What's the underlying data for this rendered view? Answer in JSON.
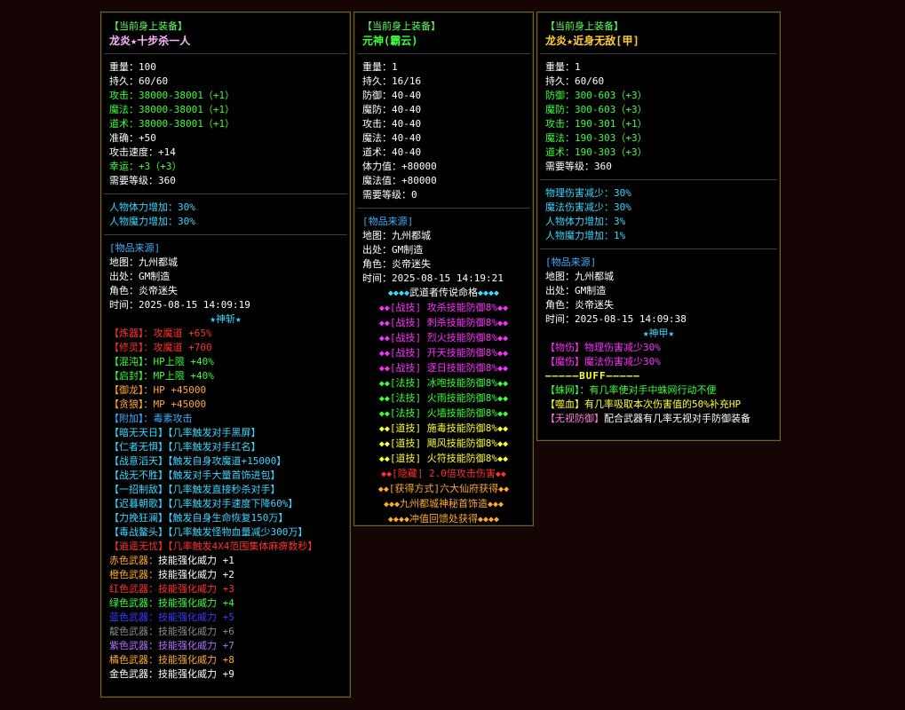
{
  "colors": {
    "white": "#ffffff",
    "green": "#3aff3a",
    "cyan": "#3ad8ff",
    "blue": "#3ab0ff",
    "red": "#ff3030",
    "magenta": "#ff30ff",
    "orange": "#ffaa30",
    "yellow": "#ffff30",
    "violet": "#c77dff",
    "purple": "#b070ff",
    "gray": "#8a8a8a",
    "dblue": "#3a3aff",
    "gold": "#ffd36b",
    "amber": "#ffa92b",
    "pink": "#ff7fd5"
  },
  "panel1": {
    "header": "【当前身上装备】",
    "title": "龙炎★十步杀一人",
    "stats": [
      {
        "label": "重量：",
        "value": "100",
        "c": "white"
      },
      {
        "label": "持久：",
        "value": "60/60",
        "c": "white"
      },
      {
        "label": "攻击：",
        "value": "38000-38001（+1）",
        "c": "green"
      },
      {
        "label": "魔法：",
        "value": "38000-38001（+1）",
        "c": "green"
      },
      {
        "label": "道术：",
        "value": "38000-38001（+1）",
        "c": "green"
      },
      {
        "label": "准确：",
        "value": "+50",
        "c": "white"
      },
      {
        "label": "攻击速度：",
        "value": "+14",
        "c": "white"
      },
      {
        "label": "幸运：",
        "value": "+3（+3）",
        "c": "green"
      },
      {
        "label": "需要等级：",
        "value": "360",
        "c": "white"
      }
    ],
    "bonus": [
      {
        "label": "人物体力增加：",
        "value": "30%",
        "c": "cyan"
      },
      {
        "label": "人物魔力增加：",
        "value": "30%",
        "c": "cyan"
      }
    ],
    "source_header": "[物品来源]",
    "source": [
      {
        "label": "地图：",
        "value": "九州都城",
        "c": "white"
      },
      {
        "label": "出处：",
        "value": "GM制造",
        "c": "white"
      },
      {
        "label": "角色：",
        "value": "炎帝迷失",
        "c": "white"
      },
      {
        "label": "时间：",
        "value": "2025-08-15 14:09:19",
        "c": "white"
      }
    ],
    "center": "★神斩★",
    "attrs": [
      {
        "a": "【炼器】：",
        "ac": "red",
        "b": "攻魔道 +65%",
        "bc": "red"
      },
      {
        "a": "【修灵】：",
        "ac": "red",
        "b": "攻魔道 +700",
        "bc": "red"
      },
      {
        "a": "【混沌】：",
        "ac": "green",
        "b": "HP上限 +40%",
        "bc": "green"
      },
      {
        "a": "【启封】：",
        "ac": "green",
        "b": "MP上限 +40%",
        "bc": "green"
      },
      {
        "a": "【御龙】：",
        "ac": "orange",
        "b": "HP +45000",
        "bc": "orange"
      },
      {
        "a": "【贪狼】：",
        "ac": "orange",
        "b": "MP +45000",
        "bc": "orange"
      },
      {
        "a": "【附加】：",
        "ac": "blue",
        "b": "毒素攻击",
        "bc": "blue"
      },
      {
        "a": "【暗无天日】",
        "ac": "cyan",
        "b": "【几率触发对手黑屏】",
        "bc": "cyan"
      },
      {
        "a": "【仁者无惧】",
        "ac": "cyan",
        "b": "【几率触发对手红名】",
        "bc": "cyan"
      },
      {
        "a": "【战意滔天】",
        "ac": "cyan",
        "b": "【触发自身攻魔道+15000】",
        "bc": "cyan"
      },
      {
        "a": "【战无不胜】",
        "ac": "cyan",
        "b": "【触发对手大量首饰进包】",
        "bc": "cyan"
      },
      {
        "a": "【一招制敌】",
        "ac": "cyan",
        "b": "【几率触发直接秒杀对手】",
        "bc": "cyan"
      },
      {
        "a": "【迟暮朝歌】",
        "ac": "cyan",
        "b": "【几率触发对手速度下降60%】",
        "bc": "cyan"
      },
      {
        "a": "【力挽狂澜】",
        "ac": "cyan",
        "b": "【触发自身生命恢复150万】",
        "bc": "cyan"
      },
      {
        "a": "【毒战鳌头】",
        "ac": "cyan",
        "b": "【几率触发怪物血量减少300万】",
        "bc": "cyan"
      },
      {
        "a": "【逍遥无忧】",
        "ac": "red",
        "b": "【几率触发4X4范围集体麻痹数秒】",
        "bc": "red"
      },
      {
        "a": "赤色武器：",
        "ac": "orange",
        "b": "技能强化威力 +1",
        "bc": "white"
      },
      {
        "a": "橙色武器：",
        "ac": "amber",
        "b": "技能强化威力 +2",
        "bc": "white"
      },
      {
        "a": "红色武器：",
        "ac": "red",
        "b": "技能强化威力 +3",
        "bc": "red"
      },
      {
        "a": "绿色武器：",
        "ac": "green",
        "b": "技能强化威力 +4",
        "bc": "green"
      },
      {
        "a": "蓝色武器：",
        "ac": "dblue",
        "b": "技能强化威力 +5",
        "bc": "dblue"
      },
      {
        "a": "靛色武器：",
        "ac": "gray",
        "b": "技能强化威力 +6",
        "bc": "gray"
      },
      {
        "a": "紫色武器：",
        "ac": "purple",
        "b": "技能强化威力 +7",
        "bc": "purple"
      },
      {
        "a": "橘色武器：",
        "ac": "amber",
        "b": "技能强化威力 +8",
        "bc": "amber"
      },
      {
        "a": "金色武器：",
        "ac": "white",
        "b": "技能强化威力 +9",
        "bc": "white"
      }
    ]
  },
  "panel2": {
    "header": "【当前身上装备】",
    "title": "元神(霸云)",
    "stats": [
      {
        "label": "重量：",
        "value": "1",
        "c": "white"
      },
      {
        "label": "持久：",
        "value": "16/16",
        "c": "white"
      },
      {
        "label": "防御：",
        "value": "40-40",
        "c": "white"
      },
      {
        "label": "魔防：",
        "value": "40-40",
        "c": "white"
      },
      {
        "label": "攻击：",
        "value": "40-40",
        "c": "white"
      },
      {
        "label": "魔法：",
        "value": "40-40",
        "c": "white"
      },
      {
        "label": "道术：",
        "value": "40-40",
        "c": "white"
      },
      {
        "label": "体力值：",
        "value": "+80000",
        "c": "white"
      },
      {
        "label": "魔法值：",
        "value": "+80000",
        "c": "white"
      },
      {
        "label": "需要等级：",
        "value": "0",
        "c": "white"
      }
    ],
    "source_header": "[物品来源]",
    "source": [
      {
        "label": "地图：",
        "value": "九州都城",
        "c": "white"
      },
      {
        "label": "出处：",
        "value": "GM制造",
        "c": "white"
      },
      {
        "label": "角色：",
        "value": "炎帝迷失",
        "c": "white"
      },
      {
        "label": "时间：",
        "value": "2025-08-15 14:19:21",
        "c": "white"
      }
    ],
    "rows": [
      {
        "l": "◆◆◆◆",
        "lc": "cyan",
        "t": "武道者传说命格",
        "tc": "white",
        "r": "◆◆◆◆",
        "rc": "cyan"
      },
      {
        "l": "◆◆",
        "lc": "magenta",
        "t": "[战技] 攻杀技能防御8%",
        "tc": "magenta",
        "r": "◆◆",
        "rc": "magenta"
      },
      {
        "l": "◆◆",
        "lc": "magenta",
        "t": "[战技] 刺杀技能防御8%",
        "tc": "magenta",
        "r": "◆◆",
        "rc": "magenta"
      },
      {
        "l": "◆◆",
        "lc": "magenta",
        "t": "[战技] 烈火技能防御8%",
        "tc": "magenta",
        "r": "◆◆",
        "rc": "magenta"
      },
      {
        "l": "◆◆",
        "lc": "magenta",
        "t": "[战技] 开天技能防御8%",
        "tc": "magenta",
        "r": "◆◆",
        "rc": "magenta"
      },
      {
        "l": "◆◆",
        "lc": "magenta",
        "t": "[战技] 逐日技能防御8%",
        "tc": "magenta",
        "r": "◆◆",
        "rc": "magenta"
      },
      {
        "l": "◆◆",
        "lc": "green",
        "t": "[法技] 冰咆技能防御8%",
        "tc": "green",
        "r": "◆◆",
        "rc": "green"
      },
      {
        "l": "◆◆",
        "lc": "green",
        "t": "[法技] 火雨技能防御8%",
        "tc": "green",
        "r": "◆◆",
        "rc": "green"
      },
      {
        "l": "◆◆",
        "lc": "green",
        "t": "[法技] 火墙技能防御8%",
        "tc": "green",
        "r": "◆◆",
        "rc": "green"
      },
      {
        "l": "◆◆",
        "lc": "yellow",
        "t": "[道技] 施毒技能防御8%",
        "tc": "yellow",
        "r": "◆◆",
        "rc": "yellow"
      },
      {
        "l": "◆◆",
        "lc": "yellow",
        "t": "[道技] 飓风技能防御8%",
        "tc": "yellow",
        "r": "◆◆",
        "rc": "yellow"
      },
      {
        "l": "◆◆",
        "lc": "yellow",
        "t": "[道技] 火符技能防御8%",
        "tc": "yellow",
        "r": "◆◆",
        "rc": "yellow"
      },
      {
        "l": "◆◆",
        "lc": "red",
        "t": "[隐藏] 2.0倍攻击伤害",
        "tc": "red",
        "r": "◆◆",
        "rc": "red"
      },
      {
        "l": "◆◆",
        "lc": "amber",
        "t": "[获得方式]六大仙府获得",
        "tc": "amber",
        "r": "◆◆",
        "rc": "amber"
      },
      {
        "l": "◆◆◆",
        "lc": "amber",
        "t": "九州都城神秘首饰造",
        "tc": "amber",
        "r": "◆◆◆",
        "rc": "amber"
      },
      {
        "l": "◆◆◆◆",
        "lc": "amber",
        "t": "冲值回馈处获得",
        "tc": "amber",
        "r": "◆◆◆◆",
        "rc": "amber"
      }
    ]
  },
  "panel3": {
    "header": "【当前身上装备】",
    "title": "龙炎★近身无敌[甲]",
    "stats": [
      {
        "label": "重量：",
        "value": "1",
        "c": "white"
      },
      {
        "label": "持久：",
        "value": "60/60",
        "c": "white"
      },
      {
        "label": "防御：",
        "value": "300-603（+3）",
        "c": "green"
      },
      {
        "label": "魔防：",
        "value": "300-603（+3）",
        "c": "green"
      },
      {
        "label": "攻击：",
        "value": "190-301（+1）",
        "c": "green"
      },
      {
        "label": "魔法：",
        "value": "190-303（+3）",
        "c": "green"
      },
      {
        "label": "道术：",
        "value": "190-303（+3）",
        "c": "green"
      },
      {
        "label": "需要等级：",
        "value": "360",
        "c": "white"
      }
    ],
    "bonus": [
      {
        "label": "物理伤害减少：",
        "value": "30%",
        "c": "cyan"
      },
      {
        "label": "魔法伤害减少：",
        "value": "30%",
        "c": "cyan"
      },
      {
        "label": "人物体力增加：",
        "value": "3%",
        "c": "cyan"
      },
      {
        "label": "人物魔力增加：",
        "value": "1%",
        "c": "cyan"
      }
    ],
    "source_header": "[物品来源]",
    "source": [
      {
        "label": "地图：",
        "value": "九州都城",
        "c": "white"
      },
      {
        "label": "出处：",
        "value": "GM制造",
        "c": "white"
      },
      {
        "label": "角色：",
        "value": "炎帝迷失",
        "c": "white"
      },
      {
        "label": "时间：",
        "value": "2025-08-15 14:09:38",
        "c": "white"
      }
    ],
    "center": "★神甲★",
    "attrs": [
      {
        "a": "【物伤】",
        "ac": "magenta",
        "b": "物理伤害减少30%",
        "bc": "magenta"
      },
      {
        "a": "【魔伤】",
        "ac": "magenta",
        "b": "魔法伤害减少30%",
        "bc": "magenta"
      }
    ],
    "buff_line": "—————BUFF—————",
    "buffs": [
      {
        "a": "【蛛网】",
        "ac": "green",
        "b": "：有几率使对手中蛛网行动不便",
        "bc": "green"
      },
      {
        "a": "【噬血】",
        "ac": "yellow",
        "b": "有几率吸取本次伤害值的50%补充HP",
        "bc": "yellow"
      },
      {
        "a": "【无视防御】",
        "ac": "pink",
        "b": "配合武器有几率无视对手防御装备",
        "bc": "white"
      }
    ]
  }
}
